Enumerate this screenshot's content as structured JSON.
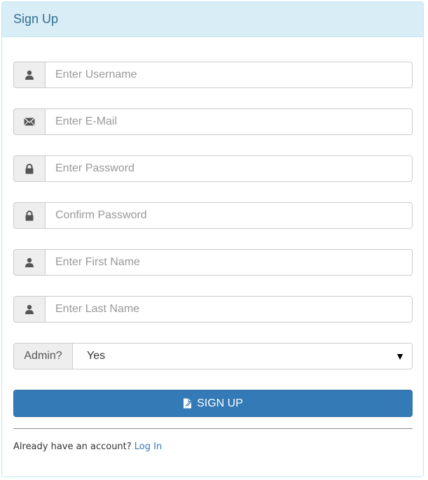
{
  "panel": {
    "title": "Sign Up"
  },
  "fields": {
    "username": {
      "placeholder": "Enter Username",
      "icon": "user-icon"
    },
    "email": {
      "placeholder": "Enter E-Mail",
      "icon": "envelope-icon"
    },
    "password": {
      "placeholder": "Enter Password",
      "icon": "lock-icon"
    },
    "confirm_password": {
      "placeholder": "Confirm Password",
      "icon": "lock-icon"
    },
    "first_name": {
      "placeholder": "Enter First Name",
      "icon": "user-icon"
    },
    "last_name": {
      "placeholder": "Enter Last Name",
      "icon": "user-icon"
    }
  },
  "admin": {
    "label": "Admin?",
    "selected": "Yes"
  },
  "submit": {
    "label": "SIGN UP",
    "icon": "edit-icon"
  },
  "footer": {
    "text": "Already have an account? ",
    "link": "Log In"
  },
  "colors": {
    "heading_bg": "#d9edf7",
    "heading_text": "#31708f",
    "primary": "#337ab7",
    "addon_bg": "#eeeeee"
  }
}
